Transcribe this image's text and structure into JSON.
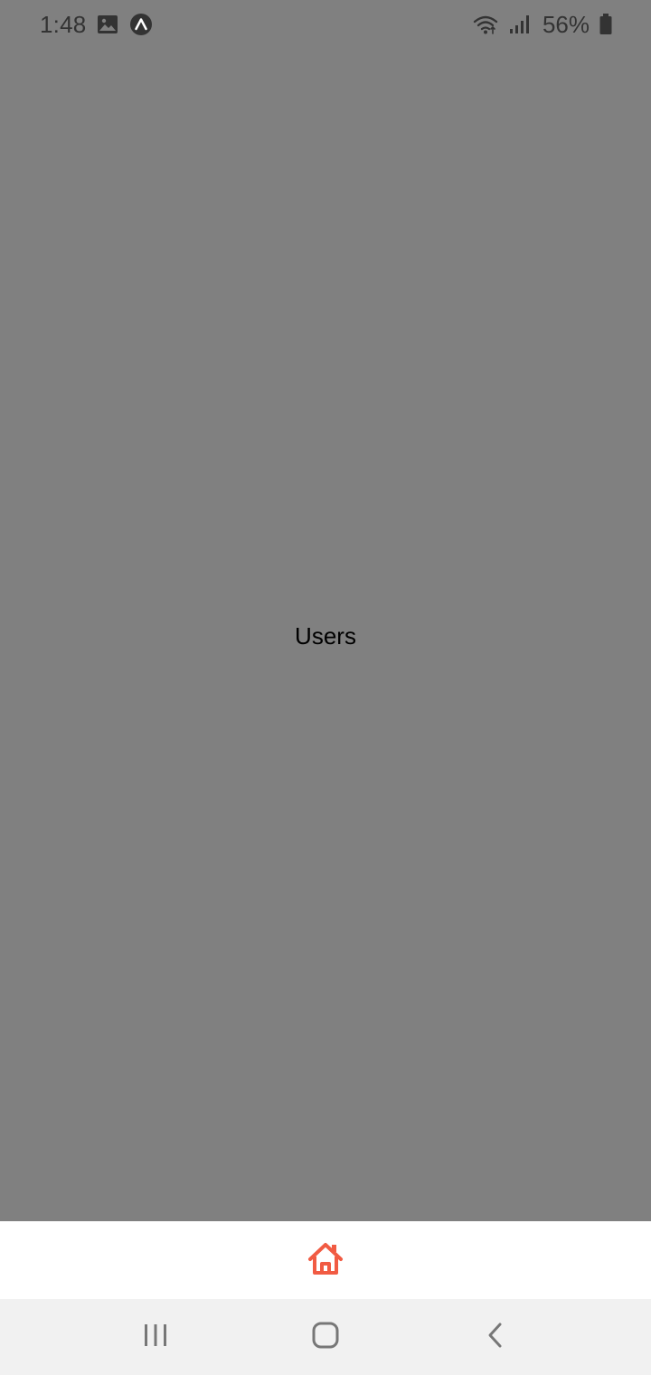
{
  "status_bar": {
    "time": "1:48",
    "battery_percent": "56%",
    "icons": [
      "image-icon",
      "expo-icon",
      "wifi-icon",
      "signal-icon",
      "battery-icon"
    ]
  },
  "main": {
    "title": "Users"
  },
  "tab_bar": {
    "active_tab_icon": "home-icon",
    "active_color": "#f15b43"
  },
  "nav_bar": {
    "buttons": [
      "recent-apps-icon",
      "home-nav-icon",
      "back-icon"
    ]
  },
  "colors": {
    "background": "#808080",
    "status_text": "#333333",
    "tab_bar_background": "#ffffff",
    "nav_bar_background": "#f1f1f1",
    "title_text": "#000000"
  }
}
